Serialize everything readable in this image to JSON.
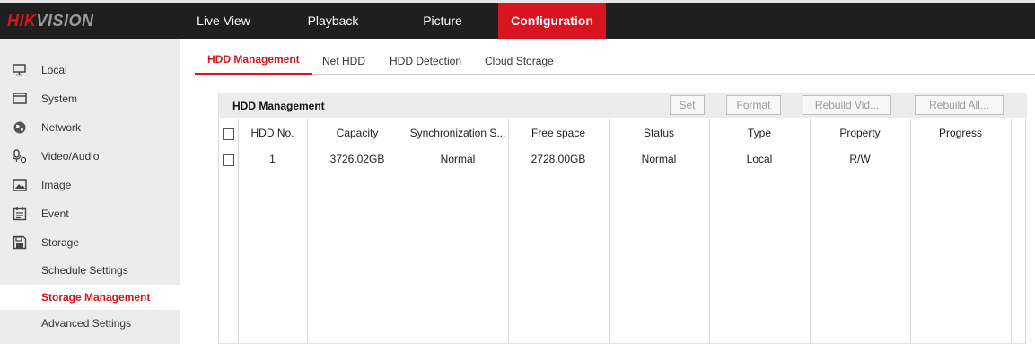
{
  "brand": {
    "part1": "HIK",
    "part2": "VISION"
  },
  "nav": {
    "live_view": "Live View",
    "playback": "Playback",
    "picture": "Picture",
    "configuration": "Configuration"
  },
  "sidebar": {
    "items": [
      {
        "label": "Local",
        "icon": "monitor-icon"
      },
      {
        "label": "System",
        "icon": "system-window-icon"
      },
      {
        "label": "Network",
        "icon": "globe-icon"
      },
      {
        "label": "Video/Audio",
        "icon": "microphone-icon"
      },
      {
        "label": "Image",
        "icon": "image-icon"
      },
      {
        "label": "Event",
        "icon": "calendar-icon"
      },
      {
        "label": "Storage",
        "icon": "floppy-disk-icon"
      }
    ],
    "storage_sub": [
      {
        "label": "Schedule Settings"
      },
      {
        "label": "Storage Management"
      },
      {
        "label": "Advanced Settings"
      }
    ]
  },
  "tabs": [
    "HDD Management",
    "Net HDD",
    "HDD Detection",
    "Cloud Storage"
  ],
  "panel": {
    "title": "HDD Management",
    "buttons": {
      "set": "Set",
      "format": "Format",
      "rebuild_video": "Rebuild Vid...",
      "rebuild_all": "Rebuild All..."
    }
  },
  "table": {
    "columns": [
      "HDD No.",
      "Capacity",
      "Synchronization S...",
      "Free space",
      "Status",
      "Type",
      "Property",
      "Progress"
    ],
    "rows": [
      {
        "hdd_no": "1",
        "capacity": "3726.02GB",
        "sync": "Normal",
        "free_space": "2728.00GB",
        "status": "Normal",
        "type": "Local",
        "property": "R/W",
        "progress": ""
      }
    ]
  },
  "colors": {
    "accent": "#d7141f",
    "topbar": "#1f1f1f",
    "sidebar": "#ececec"
  }
}
